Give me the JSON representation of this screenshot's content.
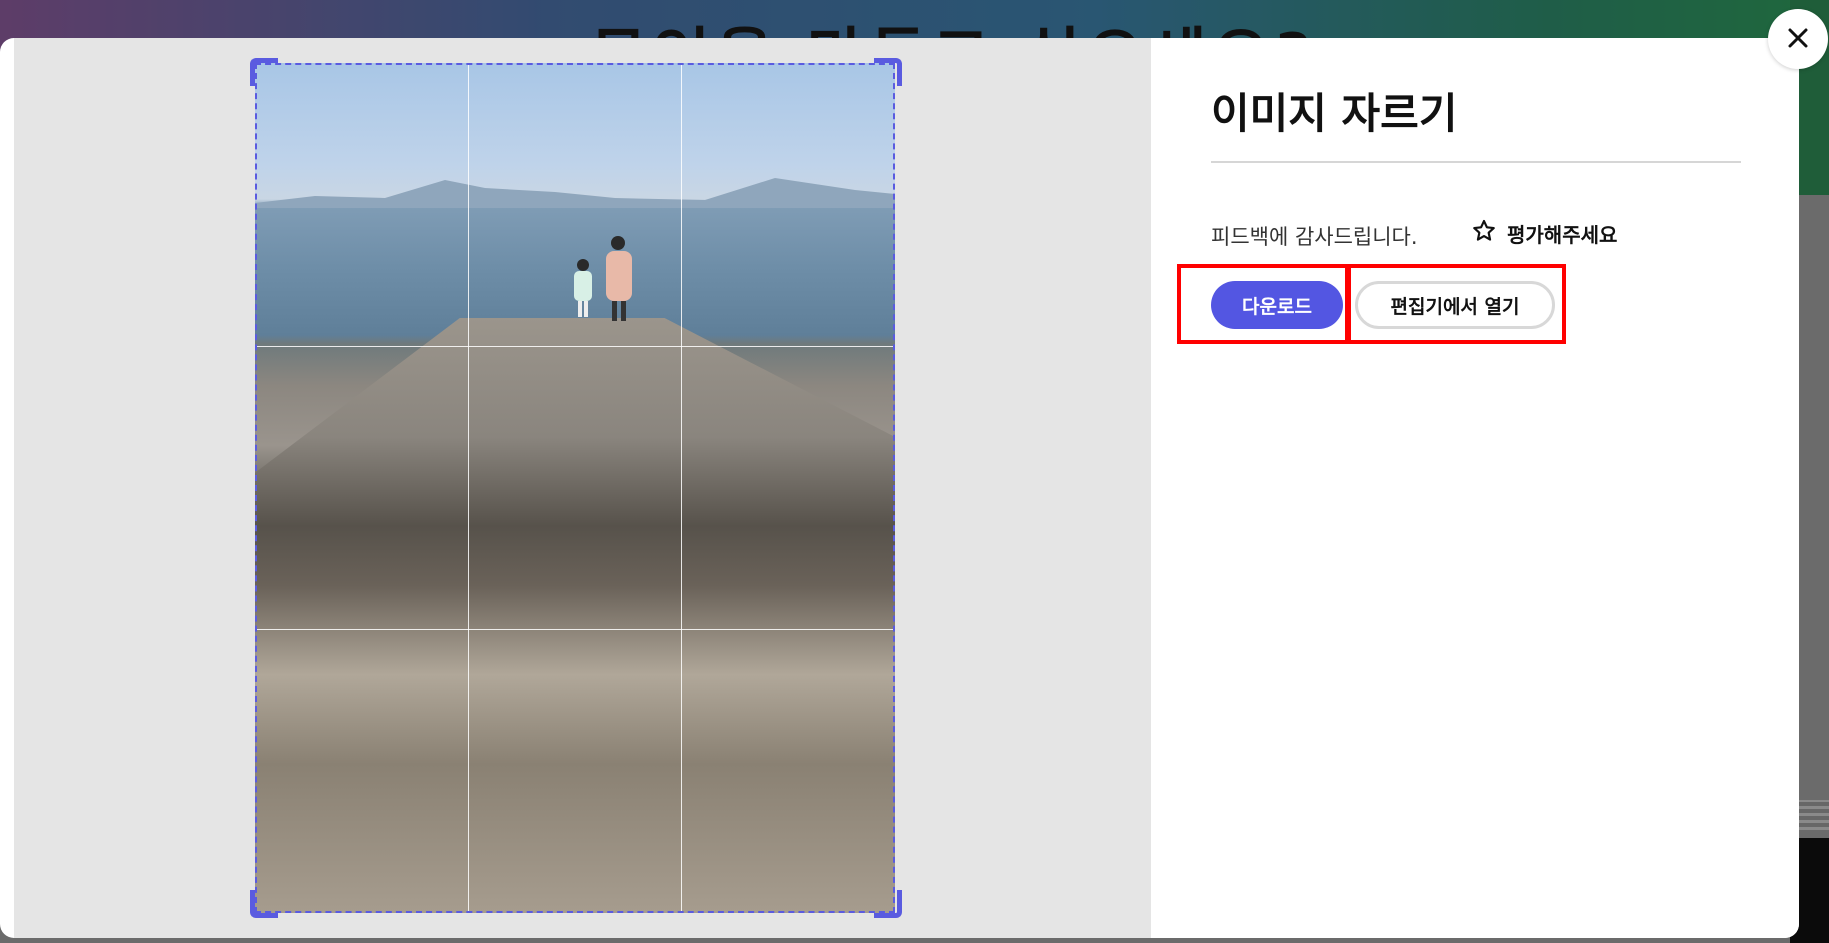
{
  "background": {
    "heading": "무엇을 만들고 싶으세요?"
  },
  "dialog": {
    "title": "이미지 자르기",
    "feedback": {
      "thanks_text": "피드백에 감사드립니다.",
      "rate_label": "평가해주세요",
      "rate_icon": "star-outline-icon"
    },
    "buttons": {
      "download": "다운로드",
      "open_in_editor": "편집기에서 열기"
    },
    "close_icon": "close-icon"
  },
  "crop": {
    "grid": "3x3",
    "accent_color": "#5a5be0"
  },
  "colors": {
    "primary_button": "#5356e2",
    "highlight": "#ff0000"
  }
}
